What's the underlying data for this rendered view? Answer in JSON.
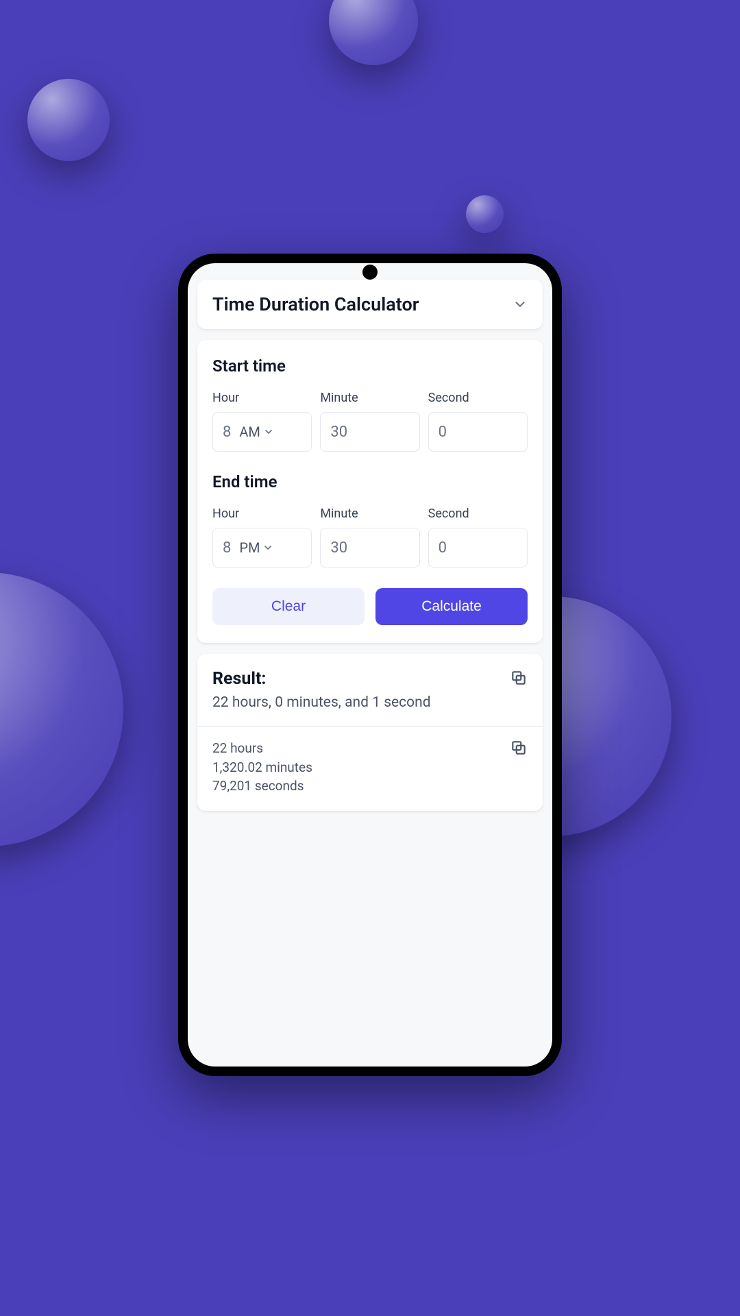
{
  "header": {
    "selector_label": "Time Duration Calculator"
  },
  "sections": {
    "start_title": "Start time",
    "end_title": "End time"
  },
  "labels": {
    "hour": "Hour",
    "minute": "Minute",
    "second": "Second"
  },
  "start": {
    "hour": "8",
    "ampm": "AM",
    "minute": "30",
    "second": "0"
  },
  "end": {
    "hour": "8",
    "ampm": "PM",
    "minute": "30",
    "second": "0"
  },
  "buttons": {
    "clear": "Clear",
    "calculate": "Calculate"
  },
  "result": {
    "title": "Result:",
    "summary": "22 hours, 0 minutes, and 1 second",
    "lines": {
      "line1": "22 hours",
      "line2": "1,320.02 minutes",
      "line3": "79,201 seconds"
    }
  },
  "colors": {
    "accent": "#4f46e5",
    "bg": "#4a3fb8"
  }
}
